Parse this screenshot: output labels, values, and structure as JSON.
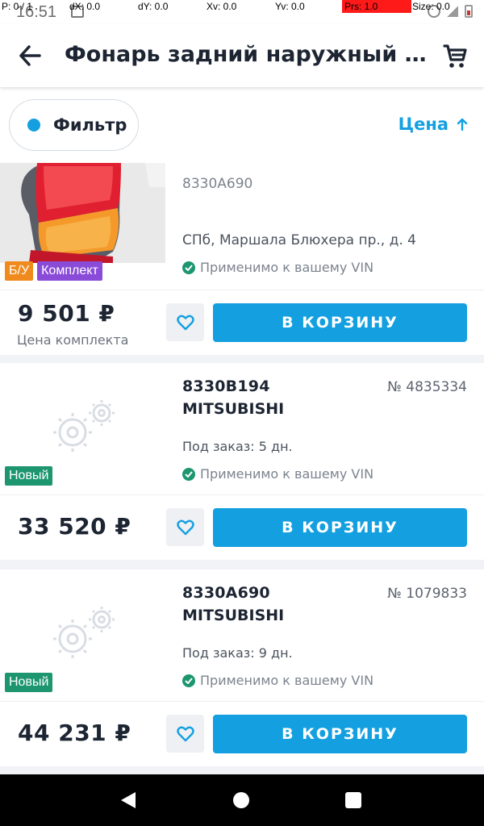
{
  "status_bar": {
    "time": "16:51"
  },
  "debug_overlay": {
    "p": "P: 0 / 1",
    "dx": "dX: 0.0",
    "dy": "dY: 0.0",
    "xv": "Xv: 0.0",
    "yv": "Yv: 0.0",
    "prs": "Prs: 1.0",
    "size": "Size: 0.0"
  },
  "header": {
    "title": "Фонарь задний наружный пра…",
    "back_icon": "arrow-left-icon",
    "cart_icon": "cart-icon"
  },
  "filter_bar": {
    "filter_label": "Фильтр",
    "sort_label": "Цена",
    "sort_icon": "arrow-up-icon",
    "accent": "#14a0e0"
  },
  "listings": [
    {
      "part_number": "8330A690",
      "location": "СПб, Маршала Блюхера пр., д. 4",
      "vin_text": "Применимо к вашему VIN",
      "badges": [
        "Б/У",
        "Комплект"
      ],
      "price": "9 501 ₽",
      "price_note": "Цена комплекта",
      "buy_label": "В КОРЗИНУ"
    },
    {
      "part_number": "8330B194",
      "brand": "MITSUBISHI",
      "order_no": "№ 4835334",
      "delivery": "Под заказ: 5 дн.",
      "vin_text": "Применимо к вашему VIN",
      "badges": [
        "Новый"
      ],
      "price": "33 520 ₽",
      "buy_label": "В КОРЗИНУ"
    },
    {
      "part_number": "8330A690",
      "brand": "MITSUBISHI",
      "order_no": "№ 1079833",
      "delivery": "Под заказ: 9 дн.",
      "vin_text": "Применимо к вашему VIN",
      "badges": [
        "Новый"
      ],
      "price": "44 231 ₽",
      "buy_label": "В КОРЗИНУ"
    }
  ]
}
